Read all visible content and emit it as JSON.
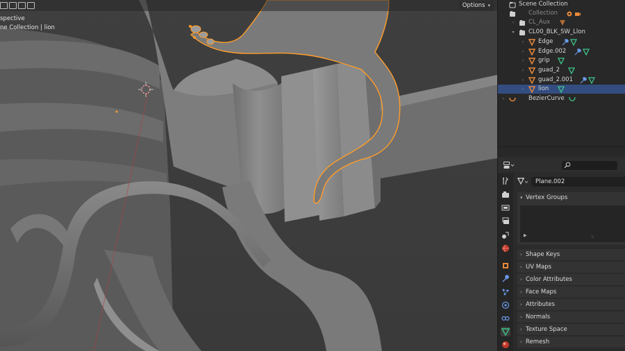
{
  "viewport": {
    "perspective_text": "spective",
    "collection_text": "ne Collection | lion",
    "options_label": "Options",
    "colors": {
      "selected_outline": "#ff9d2a",
      "background": "#3d3d3d",
      "mesh": "#8c8c8c",
      "axis_x": "#b04040"
    }
  },
  "outliner": {
    "rows": [
      {
        "label": "Scene Collection",
        "icon": "scene-collection-icon",
        "type": "scene"
      },
      {
        "label": "Collection",
        "icon": "collection-icon",
        "type": "collection",
        "dim": true
      },
      {
        "label": "CL_Aux",
        "icon": "collection-icon",
        "type": "collection",
        "dim": true
      },
      {
        "label": "CL00_BLK_SW_Llon",
        "icon": "collection-icon",
        "type": "collection"
      },
      {
        "label": "Edge",
        "icon": "mesh-object-icon",
        "type": "object"
      },
      {
        "label": "Edge.002",
        "icon": "mesh-object-icon",
        "type": "object"
      },
      {
        "label": "grip",
        "icon": "mesh-object-icon",
        "type": "object"
      },
      {
        "label": "guad_2",
        "icon": "mesh-object-icon",
        "type": "object"
      },
      {
        "label": "guad_2.001",
        "icon": "mesh-object-icon",
        "type": "object"
      },
      {
        "label": "lion",
        "icon": "mesh-object-icon",
        "type": "object",
        "selected": true
      },
      {
        "label": "BezierCurve",
        "icon": "curve-object-icon",
        "type": "object"
      }
    ],
    "colors": {
      "selection": "#334d80",
      "mesh_icon": "#e8893a",
      "data_icon": "#3ec48a",
      "modifier_icon": "#6a9ae8"
    }
  },
  "properties": {
    "datablock_name": "Plane.002",
    "panels": {
      "vertex_groups": "Vertex Groups",
      "shape_keys": "Shape Keys",
      "uv_maps": "UV Maps",
      "color_attributes": "Color Attributes",
      "face_maps": "Face Maps",
      "attributes": "Attributes",
      "normals": "Normals",
      "texture_space": "Texture Space",
      "remesh": "Remesh"
    },
    "tabs": [
      "tool-icon",
      "render-icon",
      "output-icon",
      "view-layer-icon",
      "scene-icon",
      "world-icon",
      "object-icon",
      "modifier-icon",
      "particles-icon",
      "physics-icon",
      "constraints-icon",
      "data-icon",
      "material-icon"
    ],
    "active_tab": "data-icon"
  }
}
